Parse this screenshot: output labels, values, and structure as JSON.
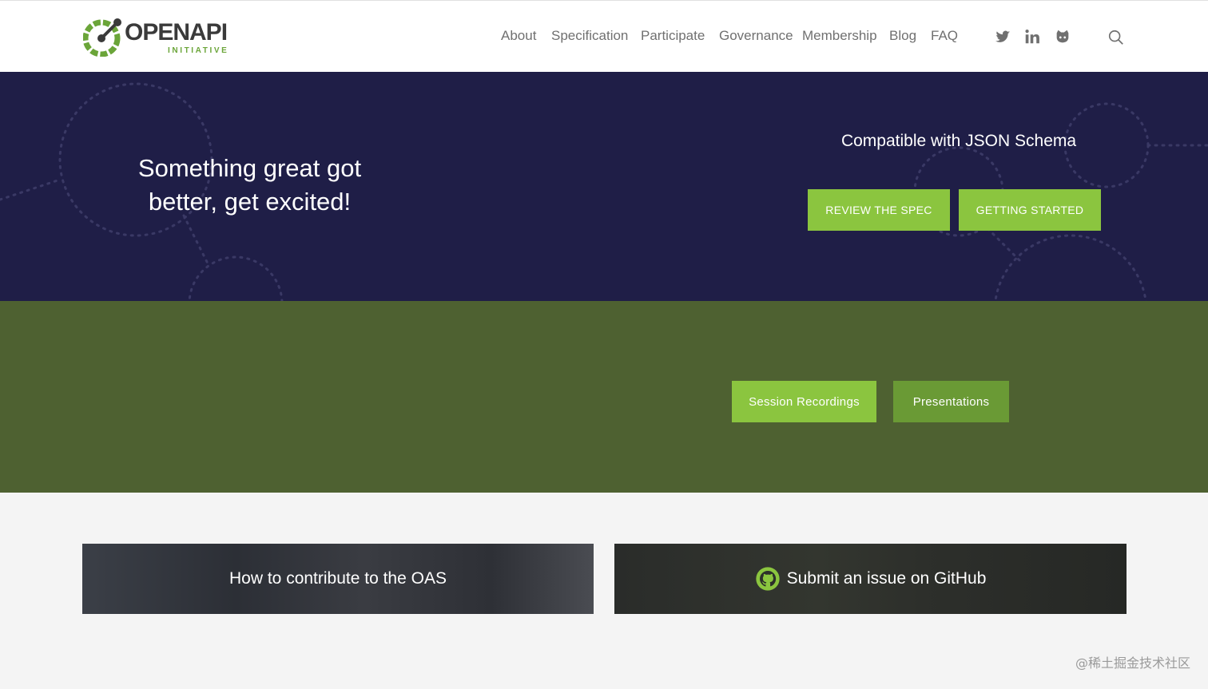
{
  "brand": {
    "name": "OPENAPI",
    "subtitle": "INITIATIVE",
    "green": "#6ba539",
    "accent_green": "#8bc53f"
  },
  "nav": {
    "items": [
      "About",
      "Specification",
      "Participate",
      "Governance",
      "Membership",
      "Blog",
      "FAQ"
    ],
    "social_icons": [
      "twitter-icon",
      "linkedin-icon",
      "github-icon"
    ],
    "search_icon": "search-icon"
  },
  "hero": {
    "title": "Something great got better, get excited!",
    "tagline": "Compatible with JSON Schema",
    "button_review": "REVIEW THE SPEC",
    "button_start": "GETTING STARTED",
    "background": "#1f1e47"
  },
  "band": {
    "button_sessions": "Session Recordings",
    "button_presentations": "Presentations",
    "background": "#4e6131"
  },
  "cards": {
    "contribute": "How to contribute to the OAS",
    "github": "Submit an issue on GitHub"
  },
  "watermark": "@稀土掘金技术社区"
}
